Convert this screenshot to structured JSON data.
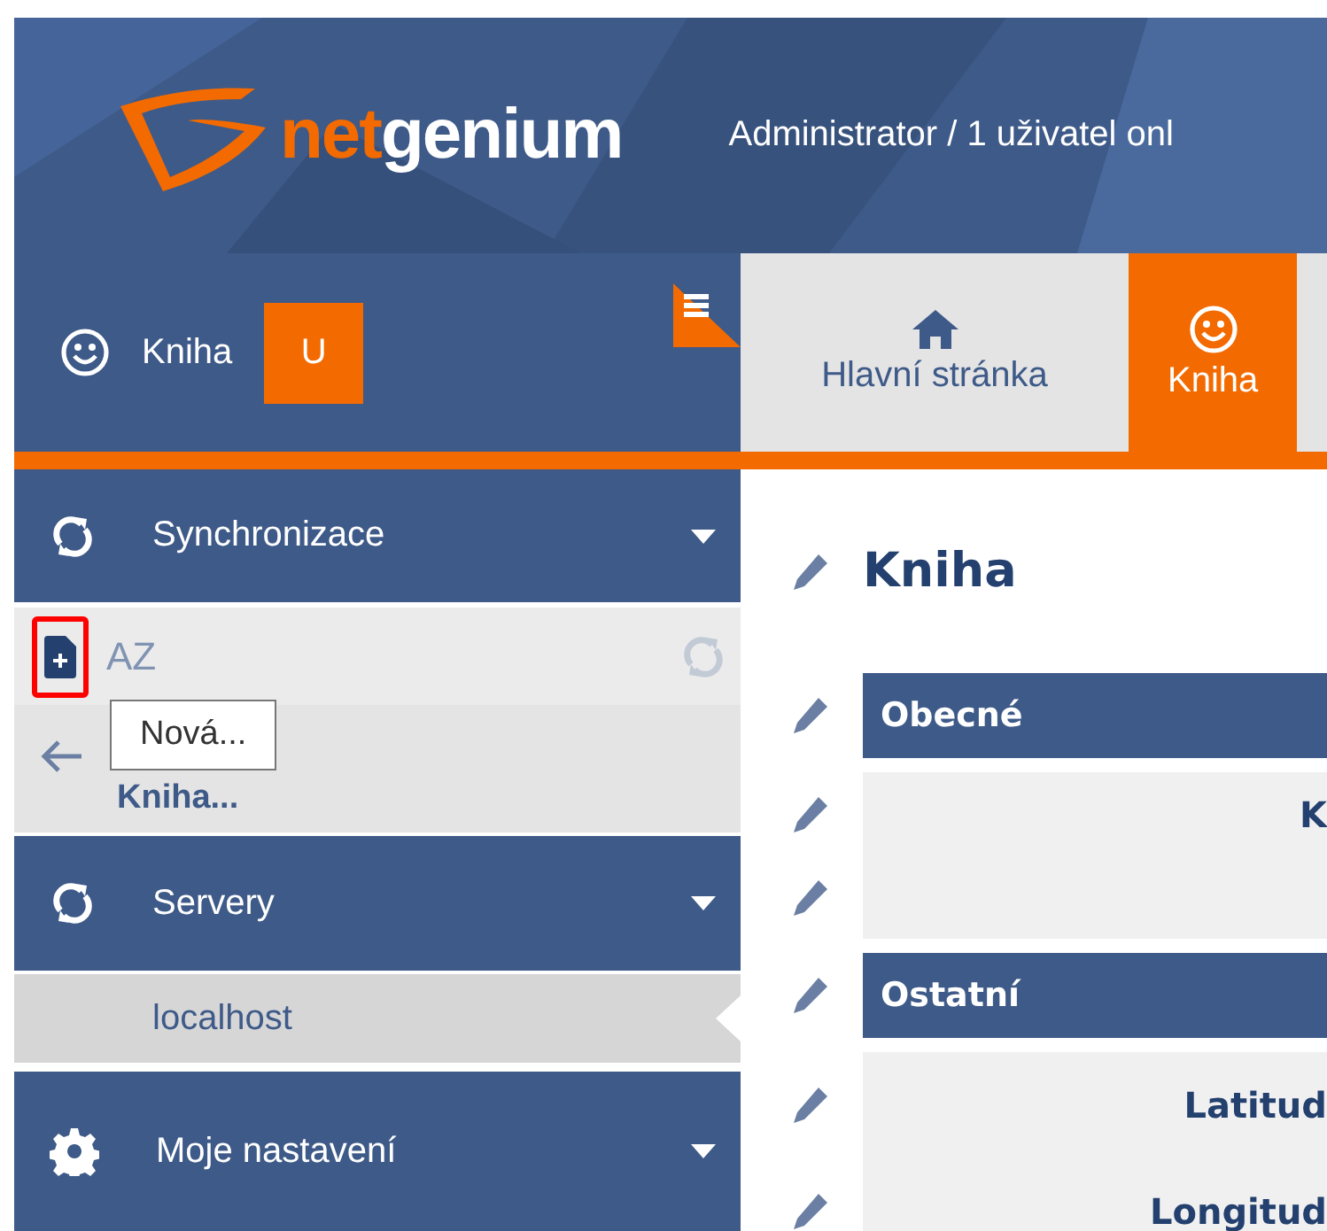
{
  "header": {
    "logo": {
      "accent": "net",
      "rest": "genium"
    },
    "user_info": "Administrator / 1 uživatel onl"
  },
  "app_panel": {
    "title": "Kniha",
    "badge": "U"
  },
  "tabs": [
    {
      "label": "Hlavní stránka",
      "kind": "home",
      "selected": false
    },
    {
      "label": "Kniha",
      "kind": "smiley",
      "selected": true
    }
  ],
  "sidebar": {
    "sections": [
      {
        "title": "Synchronizace",
        "kind": "sync",
        "toolbar": {
          "new_highlighted": true,
          "sort_label": "AZ",
          "tooltip": "Nová..."
        },
        "back_label": "Kniha..."
      },
      {
        "title": "Servery",
        "kind": "sync",
        "items": [
          {
            "label": "localhost",
            "selected": true
          }
        ]
      },
      {
        "title": "Moje nastavení",
        "kind": "gear"
      }
    ]
  },
  "main": {
    "title": "Kniha",
    "sections": [
      {
        "title": "Obecné",
        "rows": [
          {
            "kind": "field",
            "label": "K"
          },
          {
            "kind": "blank"
          }
        ]
      },
      {
        "title": "Ostatní",
        "rows": [
          {
            "kind": "field",
            "label": "Latitud"
          },
          {
            "kind": "field",
            "label": "Longitud"
          }
        ]
      }
    ]
  }
}
